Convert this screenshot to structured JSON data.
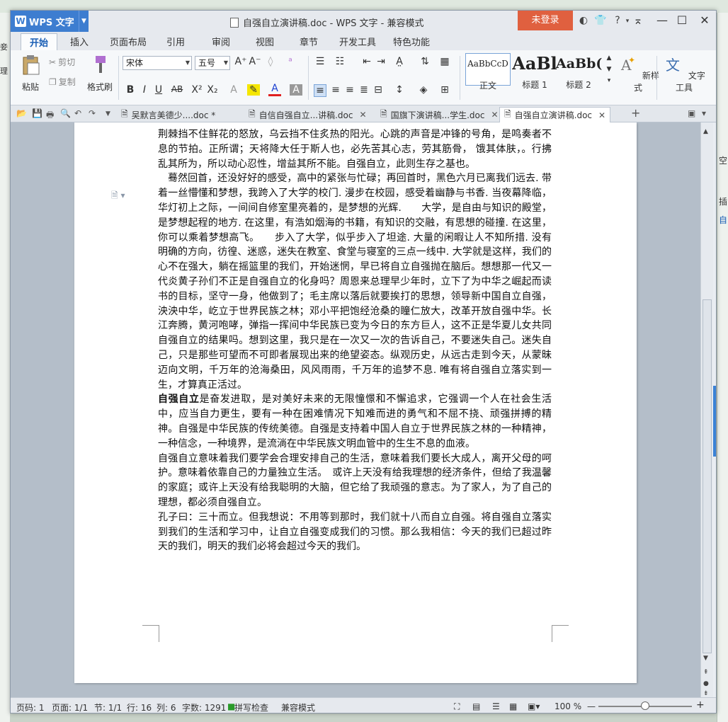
{
  "window": {
    "app_name": "WPS 文字",
    "title": "自强自立演讲稿.doc - WPS 文字 - 兼容模式",
    "login_label": "未登录",
    "help_label": "?"
  },
  "ribbon_tabs": [
    "开始",
    "插入",
    "页面布局",
    "引用",
    "审阅",
    "视图",
    "章节",
    "开发工具",
    "特色功能"
  ],
  "ribbon": {
    "paste": "粘贴",
    "cut": "剪切",
    "copy": "复制",
    "format_painter": "格式刷",
    "font_name": "宋体",
    "font_size": "五号",
    "styles": [
      {
        "sample": "AaBbCcD",
        "name": "正文"
      },
      {
        "sample": "AaBl",
        "name": "标题 1"
      },
      {
        "sample": "AaBb(",
        "name": "标题 2"
      }
    ],
    "new_style": "新样式",
    "text_tools": "文字工具"
  },
  "doc_tabs": [
    {
      "label": "吴默言美德少....doc *",
      "active": false
    },
    {
      "label": "自信自强自立...讲稿.doc",
      "active": false
    },
    {
      "label": "国旗下演讲稿...学生.doc",
      "active": false
    },
    {
      "label": "自强自立演讲稿.doc",
      "active": true
    }
  ],
  "document": {
    "para1": "荆棘挡不住鲜花的怒放，乌云挡不住炙热的阳光。心跳的声音是冲锋的号角，是鸣奏者不息的节拍。正所谓；天将降大任于斯人也，必先苦其心志，劳其筋骨， 饿其体肤，。行拂乱其所为，所以动心忍性，增益其所不能。自强自立，此则生存之基也。",
    "para2": "　蓦然回首，还没好好的感受，高中的紧张与忙碌；再回首时，黑色六月已离我们远去. 带着一丝懵懂和梦想，我跨入了大学的校门. 漫步在校园，感受着幽静与书香. 当夜幕降临，华灯初上之际，一间间自修室里亮着的，是梦想的光辉.　　大学，是自由与知识的殿堂，是梦想起程的地方. 在这里，有浩如烟海的书籍，有知识的交融，有思想的碰撞. 在这里，你可以乘着梦想高飞。　　步入了大学，似乎步入了坦途. 大量的闲暇让人不知所措. 没有明确的方向，彷徨、迷惑，迷失在教室、食堂与寝室的三点一线中. 大学就是这样，我们的心不在强大，躺在摇篮里的我们，开始迷惘，早已将自立自强抛在脑后。想想那一代又一代炎黄子孙们不正是自强自立的化身吗？周恩来总理早少年时，立下了为中华之崛起而读书的目标，坚守一身，他做到了；毛主席以落后就要挨打的思想，领导新中国自立自强，泱泱中华，屹立于世界民族之林；邓小平把饱经沧桑的瞳仁放大，改革开放自强中华。长江奔腾，黄河咆哮，弹指一挥间中华民族已变为今日的东方巨人，这不正是华夏儿女共同自强自立的结果吗。想到这里，我只是在一次又一次的告诉自己，不要迷失自己。迷失自己，只是那些可望而不可即者展现出来的绝望姿态。纵观历史，从远古走到今天，从蒙昧迈向文明，千万年的沧海桑田，风风雨雨，千万年的追梦不息. 唯有将自强自立落实到一生，才算真正活过。",
    "para3_bold": "自强自立",
    "para3_rest": "是奋发进取，是对美好未来的无限憧憬和不懈追求，它强调一个人在社会生活中，应当自力更生，要有一种在困难情况下知难而进的勇气和不屈不挠、顽强拼搏的精神。自强是中华民族的传统美德。自强是支持着中国人自立于世界民族之林的一种精神，一种信念，一种境界，是流淌在中华民族文明血管中的生生不息的血液。",
    "para4": "自强自立意味着我们要学会合理安排自己的生活，意味着我们要长大成人，离开父母的呵护。意味着依靠自己的力量独立生活。　或许上天没有给我理想的经济条件，但给了我温馨的家庭；或许上天没有给我聪明的大脑，但它给了我顽强的意志。为了家人，为了自己的理想，都必须自强自立。",
    "para5": "孔子曰：三十而立。但我想说：不用等到那时，我们就十八而自立自强。将自强自立落实到我们的生活和学习中，让自立自强变成我们的习惯。那么我相信：今天的我们已超过昨天的我们，明天的我们必将会超过今天的我们。"
  },
  "status": {
    "page_code": "页码: 1",
    "pages": "页面: 1/1",
    "section": "节: 1/1",
    "row": "行: 16",
    "col": "列: 6",
    "word_count": "字数: 1291",
    "spell_check": "拼写检查",
    "compat_mode": "兼容模式",
    "zoom": "100 %"
  },
  "background": {
    "right_peek": [
      "空",
      "插",
      "自"
    ],
    "left_peek": [
      "妾",
      "理"
    ]
  },
  "colors": {
    "app_blue": "#3d7dd0",
    "login_red": "#e0603f",
    "workspace": "#b4bec9"
  }
}
